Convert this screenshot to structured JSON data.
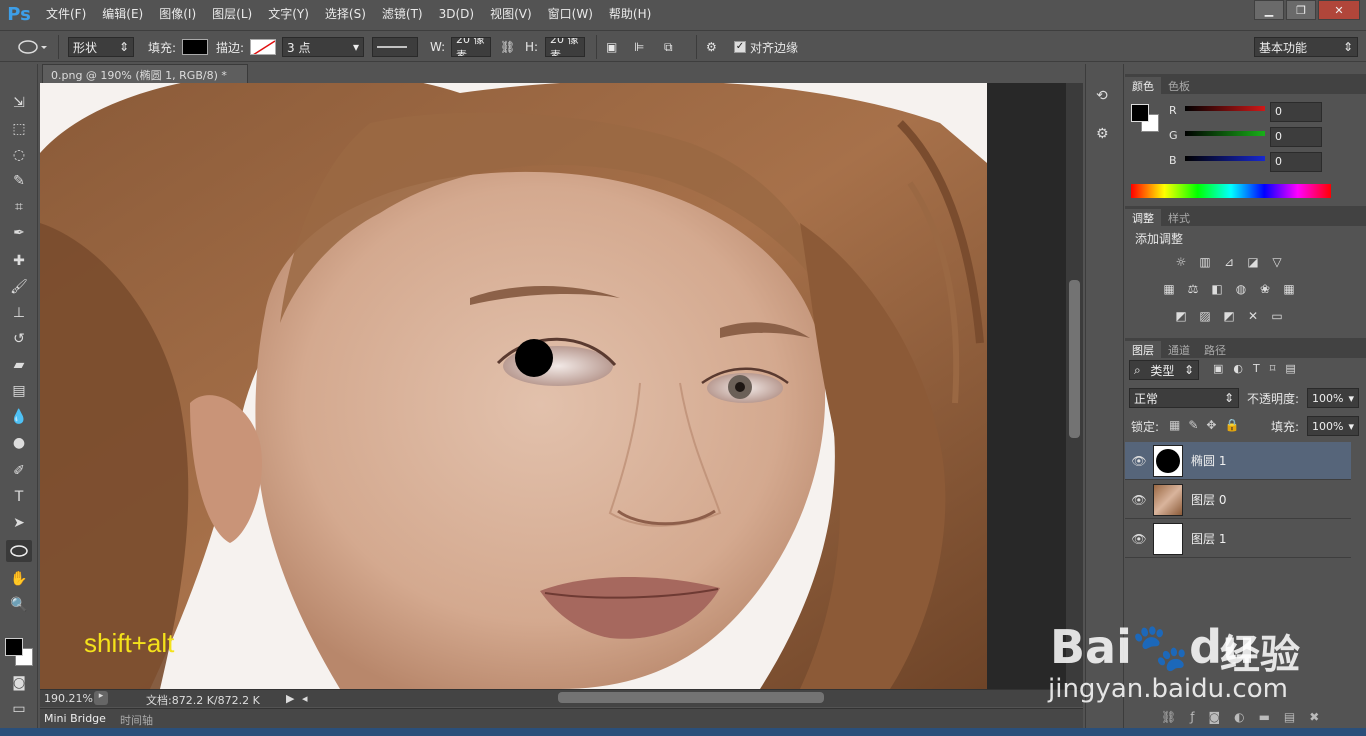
{
  "app": {
    "logo": "Ps"
  },
  "menu": [
    "文件(F)",
    "编辑(E)",
    "图像(I)",
    "图层(L)",
    "文字(Y)",
    "选择(S)",
    "滤镜(T)",
    "3D(D)",
    "视图(V)",
    "窗口(W)",
    "帮助(H)"
  ],
  "options": {
    "mode": "形状",
    "fill_label": "填充:",
    "stroke_label": "描边:",
    "stroke_size": "3 点",
    "w_label": "W:",
    "w_value": "20 像素",
    "h_label": "H:",
    "h_value": "20 像素",
    "align_edges": "对齐边缘",
    "workspace": "基本功能"
  },
  "document": {
    "tab_title": "0.png @ 190% (椭圆 1, RGB/8) *",
    "zoom": "190.21%",
    "doc_info": "文档:872.2 K/872.2 K",
    "overlay_text": "shift+alt"
  },
  "bottom_tabs": [
    "Mini Bridge",
    "时间轴"
  ],
  "color_panel": {
    "tabs": [
      "颜色",
      "色板"
    ],
    "channels": [
      {
        "label": "R",
        "value": "0",
        "color": "#d01818"
      },
      {
        "label": "G",
        "value": "0",
        "color": "#18b018"
      },
      {
        "label": "B",
        "value": "0",
        "color": "#1828d0"
      }
    ]
  },
  "adjust_panel": {
    "tabs": [
      "调整",
      "样式"
    ],
    "title": "添加调整"
  },
  "layers_panel": {
    "tabs": [
      "图层",
      "通道",
      "路径"
    ],
    "filter": "类型",
    "blend": "正常",
    "opacity_label": "不透明度:",
    "opacity": "100%",
    "lock_label": "锁定:",
    "fill_label": "填充:",
    "fill": "100%",
    "layers": [
      {
        "name": "椭圆 1",
        "selected": true
      },
      {
        "name": "图层 0",
        "selected": false
      },
      {
        "name": "图层 1",
        "selected": false
      }
    ]
  },
  "watermark": {
    "brand": "Bai",
    "brand2": "du",
    "cn": "经验",
    "url": "jingyan.baidu.com"
  }
}
